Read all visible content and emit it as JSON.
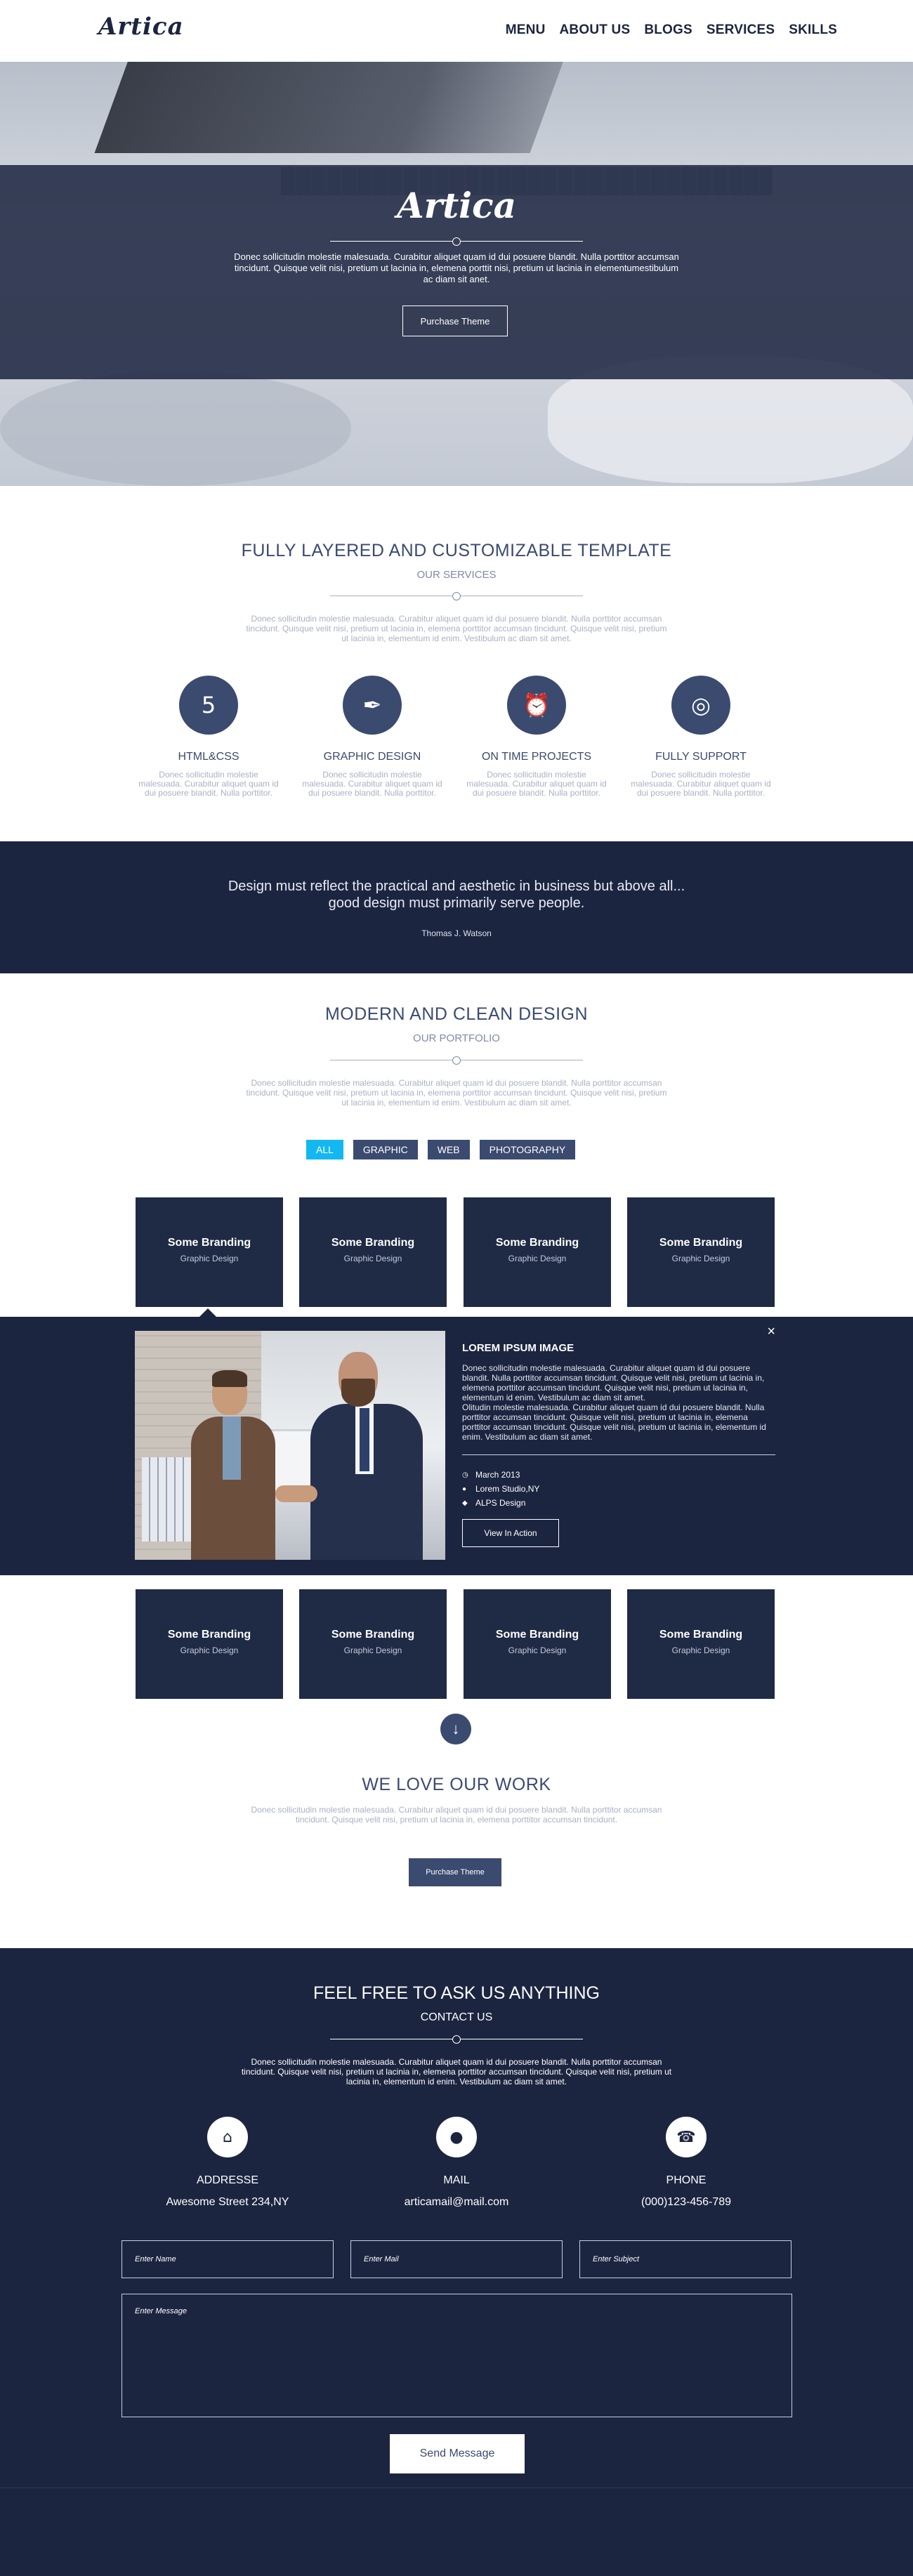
{
  "brand": {
    "logo": "Artica"
  },
  "nav": {
    "items": [
      "MENU",
      "ABOUT US",
      "BLOGS",
      "SERVICES",
      "SKILLS"
    ]
  },
  "hero": {
    "logo": "Artica",
    "text": "Donec sollicitudin molestie malesuada. Curabitur aliquet quam id dui posuere blandit. Nulla porttitor accumsan tincidunt. Quisque velit nisi, pretium ut lacinia in, elemena porttit nisi, pretium ut lacinia in elementumestibulum ac diam sit anet.",
    "button": "Purchase Theme"
  },
  "services": {
    "title": "FULLY LAYERED AND CUSTOMIZABLE TEMPLATE",
    "subtitle": "OUR SERVICES",
    "text": "Donec sollicitudin molestie malesuada. Curabitur aliquet quam id dui posuere blandit. Nulla porttitor accumsan tincidunt. Quisque velit nisi, pretium ut lacinia in, elemena porttitor accumsan tincidunt. Quisque velit nisi, pretium ut lacinia in, elementum id enim. Vestibulum ac diam sit amet.",
    "items": [
      {
        "icon": "html5-icon",
        "glyph": "5",
        "name": "HTML&CSS",
        "desc": "Donec sollicitudin molestie malesuada. Curabitur aliquet quam id dui posuere blandit. Nulla porttitor."
      },
      {
        "icon": "pen-nib-icon",
        "glyph": "✒",
        "name": "GRAPHIC DESIGN",
        "desc": "Donec sollicitudin molestie malesuada. Curabitur aliquet quam id dui posuere blandit. Nulla porttitor."
      },
      {
        "icon": "alarm-clock-icon",
        "glyph": "⏰",
        "name": "ON TIME PROJECTS",
        "desc": "Donec sollicitudin molestie malesuada. Curabitur aliquet quam id dui posuere blandit. Nulla porttitor."
      },
      {
        "icon": "lifebuoy-icon",
        "glyph": "◎",
        "name": "FULLY SUPPORT",
        "desc": "Donec sollicitudin molestie malesuada. Curabitur aliquet quam id dui posuere blandit. Nulla porttitor."
      }
    ]
  },
  "quote": {
    "text": "Design must reflect the practical and aesthetic in business but above all... good design must primarily serve people.",
    "author": "Thomas J. Watson"
  },
  "portfolio": {
    "title": "MODERN AND CLEAN DESIGN",
    "subtitle": "OUR PORTFOLIO",
    "text": "Donec sollicitudin molestie malesuada. Curabitur aliquet quam id dui posuere blandit. Nulla porttitor accumsan tincidunt. Quisque velit nisi, pretium ut lacinia in, elemena porttitor accumsan tincidunt. Quisque velit nisi, pretium ut lacinia in, elementum id enim. Vestibulum ac diam sit amet.",
    "filters": [
      "ALL",
      "GRAPHIC",
      "WEB",
      "PHOTOGRAPHY"
    ],
    "active_filter": "ALL",
    "tiles_top": [
      {
        "title": "Some Branding",
        "sub": "Graphic Design"
      },
      {
        "title": "Some Branding",
        "sub": "Graphic Design"
      },
      {
        "title": "Some Branding",
        "sub": "Graphic Design"
      },
      {
        "title": "Some Branding",
        "sub": "Graphic Design"
      }
    ],
    "tiles_bottom": [
      {
        "title": "Some Branding",
        "sub": "Graphic Design"
      },
      {
        "title": "Some Branding",
        "sub": "Graphic Design"
      },
      {
        "title": "Some Branding",
        "sub": "Graphic Design"
      },
      {
        "title": "Some Branding",
        "sub": "Graphic Design"
      }
    ],
    "detail": {
      "close": "×",
      "title": "LOREM IPSUM IMAGE",
      "paragraph1": "Donec sollicitudin molestie malesuada. Curabitur aliquet quam id dui posuere blandit. Nulla porttitor accumsan tincidunt. Quisque velit nisi, pretium ut lacinia in, elemena porttitor accumsan tincidunt. Quisque velit nisi, pretium ut lacinia in, elementum id enim. Vestibulum ac diam sit amet.",
      "paragraph2": "Olitudin molestie malesuada. Curabitur aliquet quam id dui posuere blandit. Nulla porttitor accumsan tincidunt. Quisque velit nisi, pretium ut lacinia in, elemena porttitor accumsan tincidunt. Quisque velit nisi, pretium ut lacinia in, elementum id enim. Vestibulum ac diam sit amet.",
      "date": "March 2013",
      "studio": "Lorem Studio,NY",
      "client": "ALPS Design",
      "button": "View In Action"
    },
    "more_glyph": "↓"
  },
  "love": {
    "title": "WE LOVE OUR WORK",
    "text": "Donec sollicitudin molestie malesuada. Curabitur aliquet quam id dui posuere blandit. Nulla porttitor accumsan tincidunt. Quisque velit nisi, pretium ut lacinia in, elemena porttitor accumsan tincidunt.",
    "button": "Purchase Theme"
  },
  "contact": {
    "title": "FEEL FREE TO ASK US ANYTHING",
    "subtitle": "CONTACT US",
    "text": "Donec sollicitudin molestie malesuada. Curabitur aliquet quam id dui posuere blandit. Nulla porttitor accumsan tincidunt. Quisque velit nisi, pretium ut lacinia in, elemena porttitor accumsan tincidunt. Quisque velit nisi, pretium ut lacinia in, elementum id enim. Vestibulum ac diam sit amet.",
    "info": [
      {
        "icon": "home-icon",
        "glyph": "⌂",
        "label": "ADDRESSE",
        "value": "Awesome Street 234,NY"
      },
      {
        "icon": "chat-bubble-icon",
        "glyph": "●",
        "label": "MAIL",
        "value": "articamail@mail.com"
      },
      {
        "icon": "phone-icon",
        "glyph": "☎",
        "label": "PHONE",
        "value": "(000)123-456-789"
      }
    ],
    "placeholders": {
      "name": "Enter Name",
      "mail": "Enter Mail",
      "subject": "Enter Subject",
      "message": "Enter Message"
    },
    "button": "Send Message"
  },
  "colors": {
    "navy": "#1c2540",
    "slate": "#3b4a6f",
    "accent": "#14b8f0",
    "muted": "#a9b1c6"
  }
}
